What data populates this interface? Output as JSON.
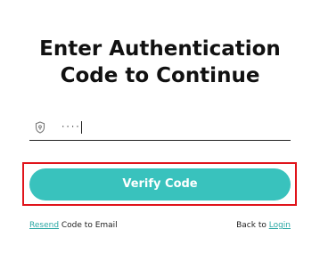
{
  "header": {
    "title_line1": "Enter Authentication",
    "title_line2": "Code to Continue"
  },
  "code_input": {
    "value": "····",
    "icon": "shield-icon"
  },
  "verify_button": {
    "label": "Verify Code"
  },
  "footer": {
    "resend_link": "Resend",
    "resend_suffix": " Code to Email",
    "back_prefix": "Back to ",
    "login_link": "Login"
  },
  "colors": {
    "accent": "#39c2bd",
    "link": "#2aa8a4",
    "highlight": "#e0141b"
  }
}
